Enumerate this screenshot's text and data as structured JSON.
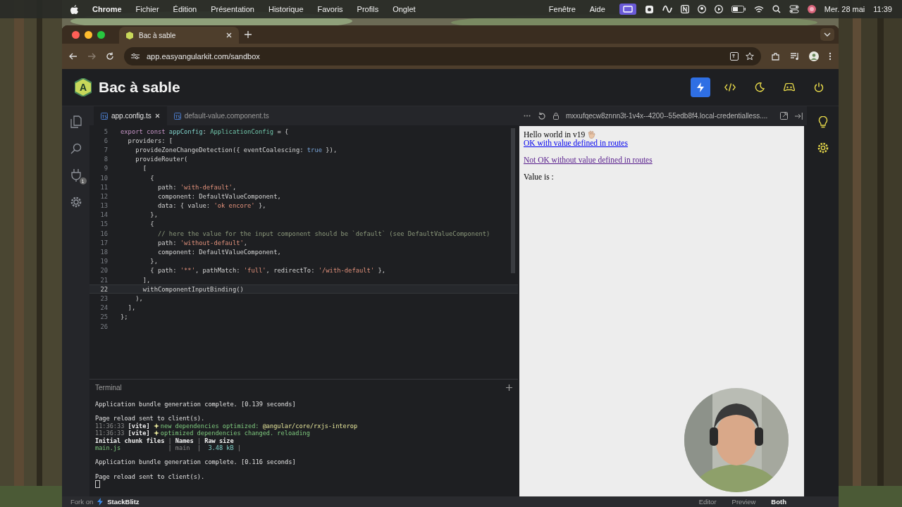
{
  "menu_bar": {
    "app": "Chrome",
    "items": [
      "Fichier",
      "Édition",
      "Présentation",
      "Historique",
      "Favoris",
      "Profils",
      "Onglet"
    ],
    "right_items": [
      "Fenêtre",
      "Aide"
    ],
    "date": "Mer. 28 mai",
    "time": "11:39"
  },
  "browser": {
    "tab": {
      "title": "Bac à sable",
      "selected": true
    },
    "url": "app.easyangularkit.com/sandbox"
  },
  "header": {
    "logo_letter": "A",
    "title": "Bac à sable"
  },
  "activity_bar": {
    "badge": "1"
  },
  "editor": {
    "tabs": [
      {
        "label": "app.config.ts",
        "selected": true
      },
      {
        "label": "default-value.component.ts",
        "selected": false
      }
    ],
    "lines": [
      {
        "number": "5",
        "current": false,
        "tokens": [
          {
            "kind": "kw",
            "text": "export const "
          },
          {
            "kind": "fn",
            "text": "appConfig"
          },
          {
            "kind": "plain",
            "text": ": "
          },
          {
            "kind": "type",
            "text": "ApplicationConfig"
          },
          {
            "kind": "plain",
            "text": " = {"
          }
        ]
      },
      {
        "number": "6",
        "current": false,
        "tokens": [
          {
            "kind": "plain",
            "text": "  providers: ["
          }
        ]
      },
      {
        "number": "7",
        "current": false,
        "tokens": [
          {
            "kind": "plain",
            "text": "    provideZoneChangeDetection({ eventCoalescing: "
          },
          {
            "kind": "bool",
            "text": "true"
          },
          {
            "kind": "plain",
            "text": " }),"
          }
        ]
      },
      {
        "number": "8",
        "current": false,
        "tokens": [
          {
            "kind": "plain",
            "text": "    provideRouter("
          }
        ]
      },
      {
        "number": "9",
        "current": false,
        "tokens": [
          {
            "kind": "plain",
            "text": "      ["
          }
        ]
      },
      {
        "number": "10",
        "current": false,
        "tokens": [
          {
            "kind": "plain",
            "text": "        {"
          }
        ]
      },
      {
        "number": "11",
        "current": false,
        "tokens": [
          {
            "kind": "plain",
            "text": "          path: "
          },
          {
            "kind": "str",
            "text": "'with-default'"
          },
          {
            "kind": "plain",
            "text": ","
          }
        ]
      },
      {
        "number": "12",
        "current": false,
        "tokens": [
          {
            "kind": "plain",
            "text": "          component: DefaultValueComponent,"
          }
        ]
      },
      {
        "number": "13",
        "current": false,
        "tokens": [
          {
            "kind": "plain",
            "text": "          data: { value: "
          },
          {
            "kind": "str",
            "text": "'ok encore'"
          },
          {
            "kind": "plain",
            "text": " },"
          }
        ]
      },
      {
        "number": "14",
        "current": false,
        "tokens": [
          {
            "kind": "plain",
            "text": "        },"
          }
        ]
      },
      {
        "number": "15",
        "current": false,
        "tokens": [
          {
            "kind": "plain",
            "text": "        {"
          }
        ]
      },
      {
        "number": "16",
        "current": false,
        "tokens": [
          {
            "kind": "comment",
            "text": "          // here the value for the input component should be `default` (see DefaultValueComponent)"
          }
        ]
      },
      {
        "number": "17",
        "current": false,
        "tokens": [
          {
            "kind": "plain",
            "text": "          path: "
          },
          {
            "kind": "str",
            "text": "'without-default'"
          },
          {
            "kind": "plain",
            "text": ","
          }
        ]
      },
      {
        "number": "18",
        "current": false,
        "tokens": [
          {
            "kind": "plain",
            "text": "          component: DefaultValueComponent,"
          }
        ]
      },
      {
        "number": "19",
        "current": false,
        "tokens": [
          {
            "kind": "plain",
            "text": "        },"
          }
        ]
      },
      {
        "number": "20",
        "current": false,
        "tokens": [
          {
            "kind": "plain",
            "text": "        { path: "
          },
          {
            "kind": "str",
            "text": "'**'"
          },
          {
            "kind": "plain",
            "text": ", pathMatch: "
          },
          {
            "kind": "str",
            "text": "'full'"
          },
          {
            "kind": "plain",
            "text": ", redirectTo: "
          },
          {
            "kind": "str",
            "text": "'/with-default'"
          },
          {
            "kind": "plain",
            "text": " },"
          }
        ]
      },
      {
        "number": "21",
        "current": false,
        "tokens": [
          {
            "kind": "plain",
            "text": "      ],"
          }
        ]
      },
      {
        "number": "22",
        "current": true,
        "tokens": [
          {
            "kind": "plain",
            "text": "      withComponentInputBinding()"
          }
        ]
      },
      {
        "number": "23",
        "current": false,
        "tokens": [
          {
            "kind": "plain",
            "text": "    ),"
          }
        ]
      },
      {
        "number": "24",
        "current": false,
        "tokens": [
          {
            "kind": "plain",
            "text": "  ],"
          }
        ]
      },
      {
        "number": "25",
        "current": false,
        "tokens": [
          {
            "kind": "plain",
            "text": "};"
          }
        ]
      },
      {
        "number": "26",
        "current": false
      }
    ]
  },
  "terminal": {
    "title": "Terminal",
    "blocks": [
      [
        {
          "tokens": [
            {
              "kind": "plain",
              "text": "Application bundle generation complete. [0.139 seconds]"
            }
          ]
        }
      ],
      [
        {
          "tokens": [
            {
              "kind": "plain",
              "text": "Page reload sent to client(s)."
            }
          ]
        },
        {
          "tokens": [
            {
              "kind": "dim",
              "text": "11:36:33 "
            },
            {
              "kind": "bold",
              "text": "[vite] "
            },
            {
              "kind": "sparkle"
            },
            {
              "kind": "green",
              "text": "new dependencies optimized: "
            },
            {
              "kind": "yellow",
              "text": "@angular/core/rxjs-interop"
            }
          ]
        },
        {
          "tokens": [
            {
              "kind": "dim",
              "text": "11:36:33 "
            },
            {
              "kind": "bold",
              "text": "[vite] "
            },
            {
              "kind": "sparkle"
            },
            {
              "kind": "green",
              "text": "optimized dependencies changed. reloading"
            }
          ]
        },
        {
          "tokens": [
            {
              "kind": "bold",
              "text": "Initial chunk files"
            },
            {
              "kind": "dim",
              "text": " | "
            },
            {
              "kind": "bold",
              "text": "Names"
            },
            {
              "kind": "dim",
              "text": " | "
            },
            {
              "kind": "bold",
              "text": "Raw size"
            }
          ]
        },
        {
          "tokens": [
            {
              "kind": "green",
              "text": "main.js            "
            },
            {
              "kind": "dim",
              "text": " | main  |  "
            },
            {
              "kind": "teal",
              "text": "3.48 kB"
            },
            {
              "kind": "dim",
              "text": " |"
            }
          ]
        }
      ],
      [
        {
          "tokens": [
            {
              "kind": "plain",
              "text": "Application bundle generation complete. [0.116 seconds]"
            }
          ]
        }
      ],
      [
        {
          "tokens": [
            {
              "kind": "plain",
              "text": "Page reload sent to client(s)."
            }
          ]
        }
      ]
    ]
  },
  "preview": {
    "url": "mxxufqecw8znnn3t-1v4x--4200--55edb8f4.local-credentialless....",
    "greeting": "Hello world in v19",
    "links": [
      {
        "text": "OK with value defined in routes",
        "visited": false
      },
      {
        "text": "Not OK without value defined in routes",
        "visited": true
      }
    ],
    "value_label": "Value is :"
  },
  "footer": {
    "fork_label": "Fork on",
    "brand": "StackBlitz",
    "views": [
      {
        "label": "Editor",
        "selected": false
      },
      {
        "label": "Preview",
        "selected": false
      },
      {
        "label": "Both",
        "selected": true
      }
    ]
  }
}
